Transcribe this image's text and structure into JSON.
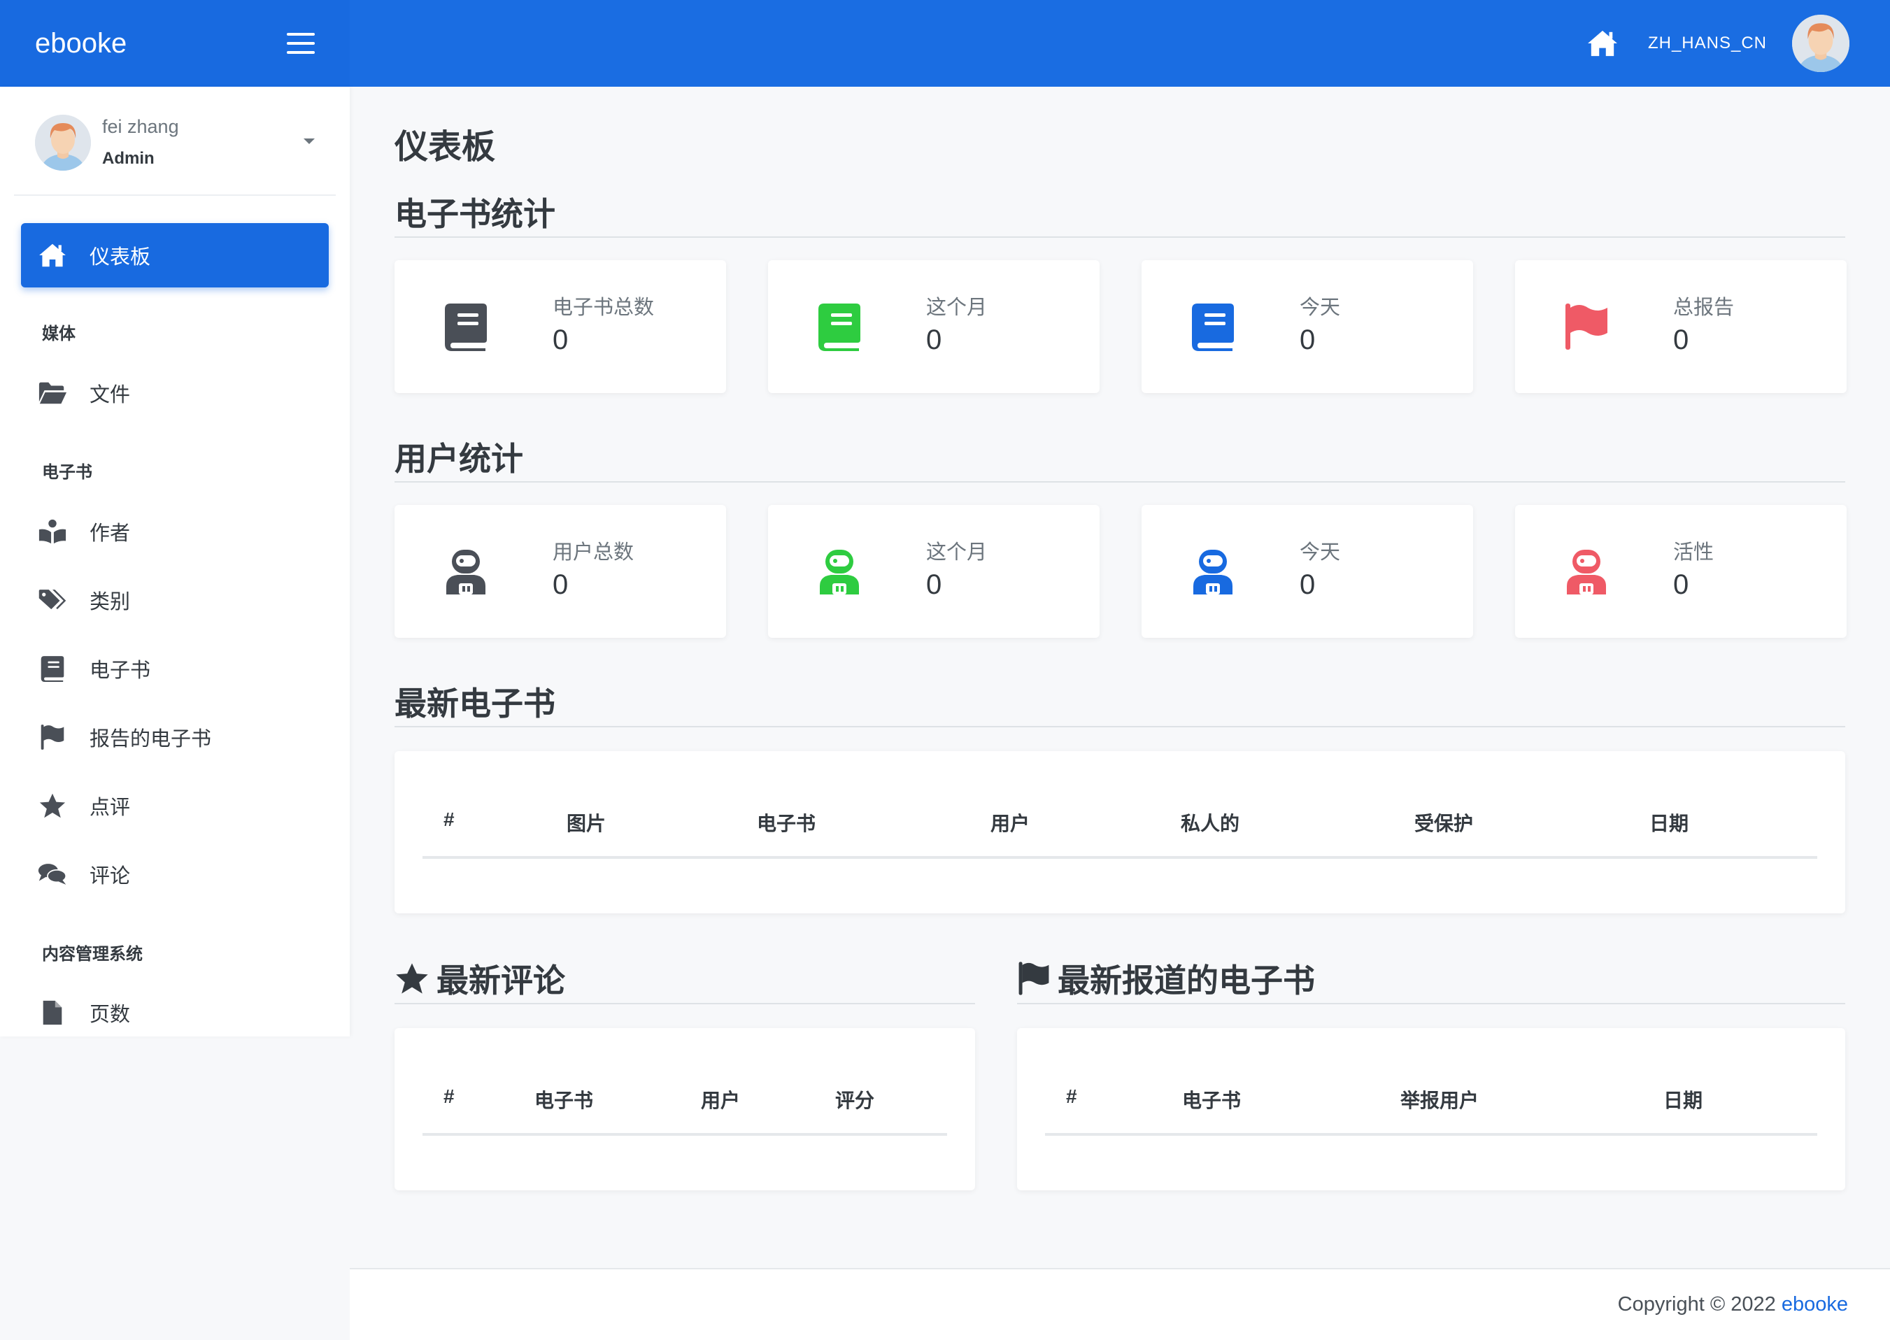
{
  "brand": {
    "name": "ebooke"
  },
  "topbar": {
    "language": "ZH_HANS_CN"
  },
  "user": {
    "name": "fei zhang",
    "role": "Admin"
  },
  "sidebar": {
    "active": {
      "label": "仪表板",
      "icon": "home-icon"
    },
    "sections": [
      {
        "header": "媒体",
        "items": [
          {
            "label": "文件",
            "icon": "folder-open-icon"
          }
        ]
      },
      {
        "header": "电子书",
        "items": [
          {
            "label": "作者",
            "icon": "book-reader-icon"
          },
          {
            "label": "类别",
            "icon": "tags-icon"
          },
          {
            "label": "电子书",
            "icon": "book-icon"
          },
          {
            "label": "报告的电子书",
            "icon": "flag-icon"
          },
          {
            "label": "点评",
            "icon": "star-icon"
          },
          {
            "label": "评论",
            "icon": "comments-icon"
          }
        ]
      },
      {
        "header": "内容管理系统",
        "items": [
          {
            "label": "页数",
            "icon": "file-icon"
          }
        ]
      }
    ]
  },
  "page": {
    "title": "仪表板"
  },
  "ebook_stats": {
    "title": "电子书统计",
    "cards": [
      {
        "label": "电子书总数",
        "value": "0",
        "icon": "book-icon",
        "color": "#4a4f57"
      },
      {
        "label": "这个月",
        "value": "0",
        "icon": "book-icon",
        "color": "#2ecc40"
      },
      {
        "label": "今天",
        "value": "0",
        "icon": "book-icon",
        "color": "#186ae0"
      },
      {
        "label": "总报告",
        "value": "0",
        "icon": "flag-icon",
        "color": "#ef5a66"
      }
    ]
  },
  "user_stats": {
    "title": "用户统计",
    "cards": [
      {
        "label": "用户总数",
        "value": "0",
        "icon": "user-astronaut-icon",
        "color": "#4a4f57"
      },
      {
        "label": "这个月",
        "value": "0",
        "icon": "user-astronaut-icon",
        "color": "#2ecc40"
      },
      {
        "label": "今天",
        "value": "0",
        "icon": "user-astronaut-icon",
        "color": "#186ae0"
      },
      {
        "label": "活性",
        "value": "0",
        "icon": "user-astronaut-icon",
        "color": "#ef5a66"
      }
    ]
  },
  "latest_ebooks": {
    "title": "最新电子书",
    "columns": [
      "#",
      "图片",
      "电子书",
      "用户",
      "私人的",
      "受保护",
      "日期"
    ]
  },
  "latest_reviews": {
    "title": "最新评论",
    "icon": "star-icon",
    "columns": [
      "#",
      "电子书",
      "用户",
      "评分"
    ]
  },
  "latest_reports": {
    "title": "最新报道的电子书",
    "icon": "flag-icon",
    "columns": [
      "#",
      "电子书",
      "举报用户",
      "日期"
    ]
  },
  "footer": {
    "copyright": "Copyright © 2022",
    "link": "ebooke"
  }
}
